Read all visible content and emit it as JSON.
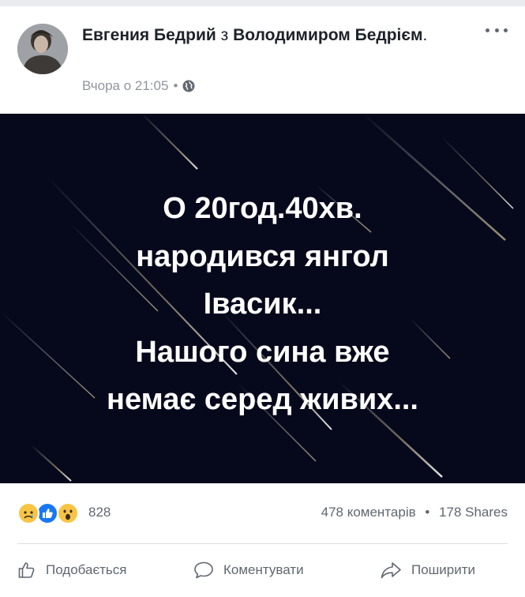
{
  "post": {
    "author": {
      "name": "Евгения Бедрий",
      "conjunction": "з",
      "tagged": "Володимиром Бедрієм",
      "suffix": "."
    },
    "timestamp": "Вчора о 21:05",
    "separator": "•",
    "privacy_icon": "globe-icon",
    "more_icon": "more-options-icon",
    "image_text": {
      "line1": "О 20год.40хв.",
      "line2": "народився янгол",
      "line3": "Івасик...",
      "line4": "Нашого сина вже",
      "line5": "немає серед живих..."
    },
    "reactions": {
      "icons": [
        "sad-icon",
        "like-icon",
        "wow-icon"
      ],
      "count": "828"
    },
    "engagement": {
      "comments": "478 коментарів",
      "separator": "•",
      "shares": "178 Shares"
    },
    "actions": {
      "like": "Подобається",
      "comment": "Коментувати",
      "share": "Поширити"
    }
  },
  "colors": {
    "image_background": "#06091c",
    "text_primary": "#1d2129",
    "text_secondary": "#606770",
    "like_blue": "#1877f2",
    "reaction_yellow": "#f7c545"
  }
}
